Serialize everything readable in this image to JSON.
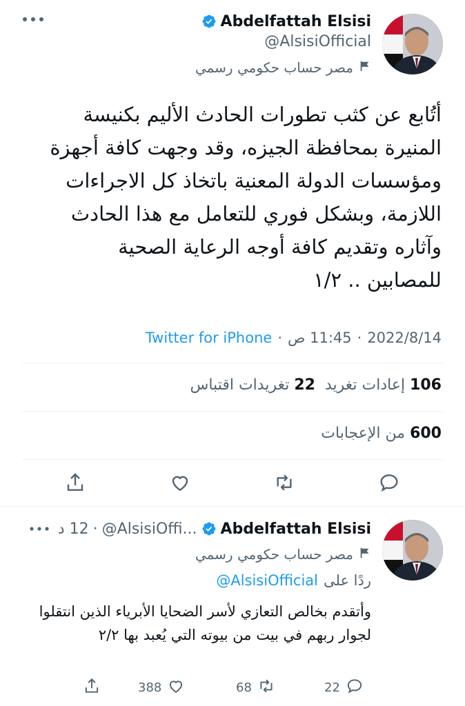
{
  "colors": {
    "accent": "#1d9bf0",
    "text": "#0f1419",
    "muted": "#536471",
    "divider": "#eff3f4"
  },
  "main_tweet": {
    "display_name": "Abdelfattah Elsisi",
    "handle": "@AlsisiOfficial",
    "label": "مصر حساب حكومي رسمي",
    "text": "أتُابع عن كثب تطورات الحادث الأليم بكنيسة المنيرة بمحافظة الجيزه، وقد وجهت كافة أجهزة ومؤسسات الدولة المعنية باتخاذ كل الاجراءات اللازمة، وبشكل فوري للتعامل مع هذا الحادث وآثاره وتقديم كافة أوجه الرعاية الصحية للمصابين .. ١/٢",
    "date": "2022/8/14",
    "time": "11:45 ص",
    "source": "Twitter for iPhone",
    "retweets_count": "106",
    "retweets_label": "إعادات تغريد",
    "quotes_count": "22",
    "quotes_label": "تغريدات اقتباس",
    "likes_count": "600",
    "likes_label": "من الإعجابات"
  },
  "reply_tweet": {
    "display_name": "Abdelfattah Elsisi",
    "handle": "@AlsisiOffi...",
    "age": "12 د",
    "label": "مصر حساب حكومي رسمي",
    "replying_prefix": "ردًا على",
    "replying_to": "@AlsisiOfficial",
    "text": "وأتقدم بخالص التعازي لأسر الضحايا الأبرياء الذين انتقلوا لجوار ربهم في بيت من بيوته التي يُعبد بها ٢/٢",
    "reply_count": "22",
    "retweet_count": "68",
    "like_count": "388"
  }
}
